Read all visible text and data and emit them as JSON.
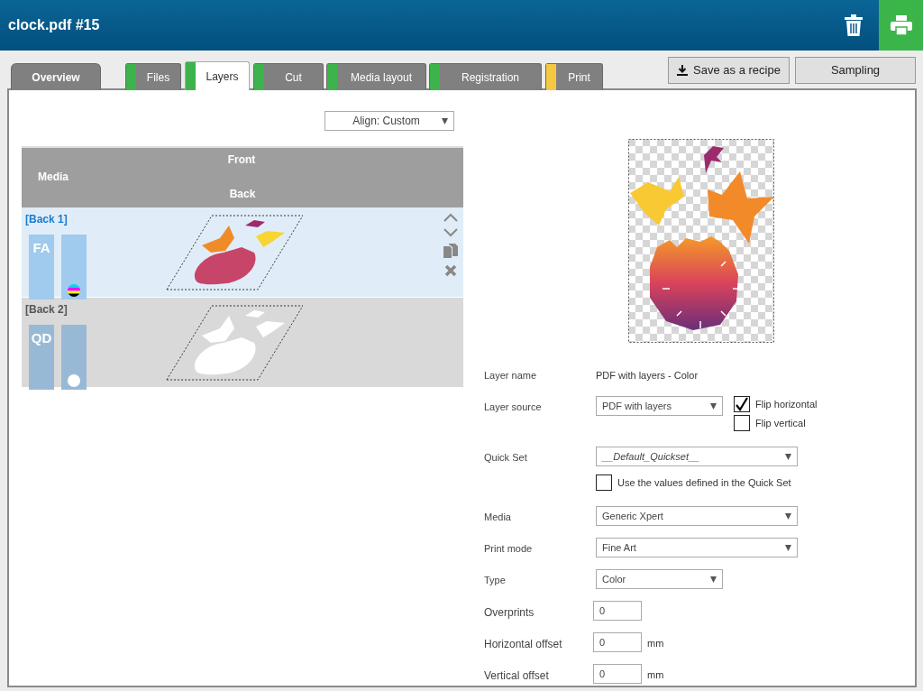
{
  "header": {
    "title": "clock.pdf #15"
  },
  "tabs": [
    {
      "label": "Overview",
      "selected": false
    },
    {
      "label": "Files",
      "selected": false,
      "color": "#3cb44b"
    },
    {
      "label": "Layers",
      "selected": true,
      "color": "#3cb44b"
    },
    {
      "label": "Cut",
      "selected": false,
      "color": "#3cb44b"
    },
    {
      "label": "Media layout",
      "selected": false,
      "color": "#3cb44b"
    },
    {
      "label": "Registration",
      "selected": false,
      "color": "#3cb44b"
    },
    {
      "label": "Print",
      "selected": false,
      "color": "#f5c842"
    }
  ],
  "actions": {
    "save_recipe": "Save as a recipe",
    "sampling": "Sampling"
  },
  "align_select": {
    "value": "Align: Custom"
  },
  "layer_table": {
    "front": "Front",
    "media": "Media",
    "back": "Back"
  },
  "layers": [
    {
      "name": "[Back 1]",
      "selected": true,
      "media_code": "FA",
      "kind": "cmyk"
    },
    {
      "name": "[Back 2]",
      "selected": false,
      "media_code": "QD",
      "kind": "white"
    }
  ],
  "properties": [
    {
      "kind": "text",
      "label": "Layer name",
      "value": "PDF with layers - Color"
    },
    {
      "kind": "select",
      "label": "Layer source",
      "value": "PDF with layers",
      "wide": false,
      "options": [
        {
          "label": "Flip horizontal",
          "checked": true
        },
        {
          "label": "Flip vertical",
          "checked": false
        }
      ]
    },
    {
      "kind": "select",
      "label": "Quick Set",
      "value": "__Default_Quickset__",
      "wide": true,
      "italic": true
    },
    {
      "kind": "checkbox",
      "label": "Use the values defined in the Quick Set",
      "checked": false
    },
    {
      "kind": "select",
      "label": "Media",
      "value": "Generic Xpert",
      "wide": true
    },
    {
      "kind": "select",
      "label": "Print mode",
      "value": "Fine Art",
      "wide": true
    },
    {
      "kind": "select",
      "label": "Type",
      "value": "Color",
      "wide": false
    },
    {
      "kind": "input",
      "label": "Overprints",
      "value": "0"
    },
    {
      "kind": "input",
      "label": "Horizontal offset",
      "value": "0",
      "unit": "mm"
    },
    {
      "kind": "input",
      "label": "Vertical offset",
      "value": "0",
      "unit": "mm"
    }
  ]
}
